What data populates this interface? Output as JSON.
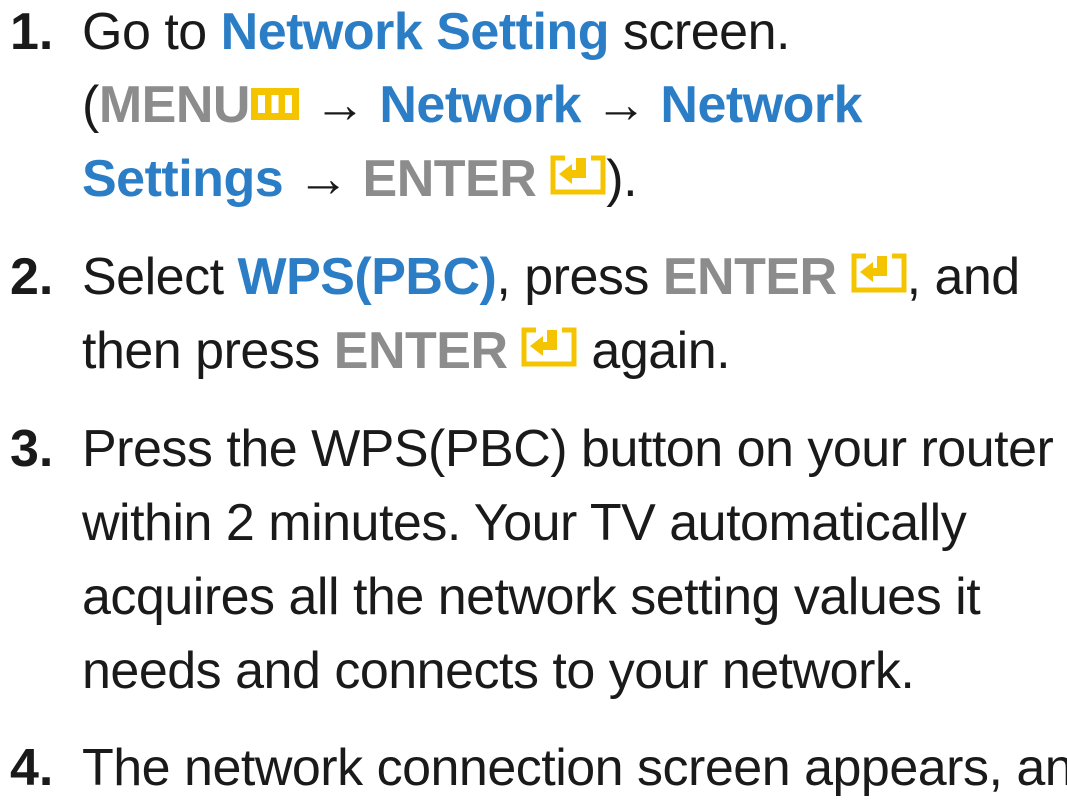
{
  "steps": [
    {
      "number": "1.",
      "l1_pre": "Go to ",
      "l1_hl": "Network Setting",
      "l1_post": " screen.",
      "l2_open": "(",
      "l2_menu": "MENU",
      "l2_arrow1": " → ",
      "l2_hl1": "Network",
      "l2_arrow2": " → ",
      "l2_hl2": "Network",
      "l3_hl": "Settings",
      "l3_arrow": " → ",
      "l3_enter": "ENTER",
      "l3_close": ")."
    },
    {
      "number": "2.",
      "l1_pre": "Select ",
      "l1_hl": "WPS(PBC)",
      "l1_mid": ", press ",
      "l1_enter": "ENTER",
      "l1_post": ", and",
      "l2_pre": "then press ",
      "l2_enter": "ENTER",
      "l2_post": " again."
    },
    {
      "number": "3.",
      "lines": [
        "Press the WPS(PBC) button on your router",
        "within 2 minutes. Your TV automatically",
        "acquires all the network setting values it",
        "needs and connects to your network."
      ]
    },
    {
      "number": "4.",
      "line1": "The network connection screen appears, an"
    }
  ],
  "icons": {
    "menu": "menu-icon",
    "enter": "enter-icon"
  },
  "colors": {
    "highlight_blue": "#2b7ec6",
    "button_gray": "#8c8c8c",
    "icon_yellow": "#f5c400"
  }
}
